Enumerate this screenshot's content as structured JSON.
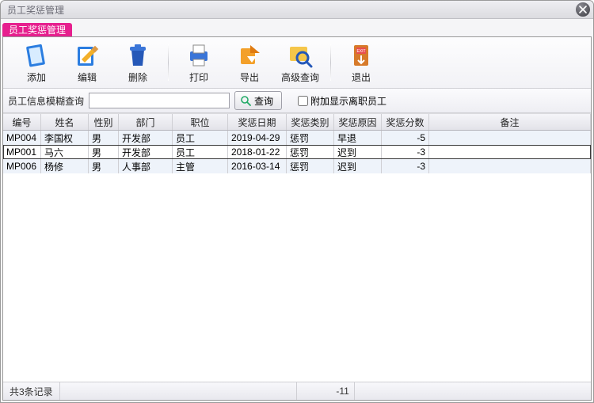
{
  "window": {
    "title": "员工奖惩管理"
  },
  "tab": {
    "label": "员工奖惩管理"
  },
  "toolbar": {
    "add": "添加",
    "edit": "编辑",
    "delete": "删除",
    "print": "打印",
    "export": "导出",
    "adv_query": "高级查询",
    "exit": "退出"
  },
  "filter": {
    "label": "员工信息模糊查询",
    "value": "",
    "query_btn": "查询",
    "show_resigned_label": "附加显示离职员工",
    "show_resigned_checked": false
  },
  "grid": {
    "columns": [
      "编号",
      "姓名",
      "性别",
      "部门",
      "职位",
      "奖惩日期",
      "奖惩类别",
      "奖惩原因",
      "奖惩分数",
      "备注"
    ],
    "rows": [
      {
        "id": "MP004",
        "name": "李国权",
        "gender": "男",
        "dept": "开发部",
        "pos": "员工",
        "date": "2019-04-29",
        "type": "惩罚",
        "reason": "早退",
        "score": "-5",
        "note": "",
        "alt": true,
        "sel": false
      },
      {
        "id": "MP001",
        "name": "马六",
        "gender": "男",
        "dept": "开发部",
        "pos": "员工",
        "date": "2018-01-22",
        "type": "惩罚",
        "reason": "迟到",
        "score": "-3",
        "note": "",
        "alt": false,
        "sel": true
      },
      {
        "id": "MP006",
        "name": "杨修",
        "gender": "男",
        "dept": "人事部",
        "pos": "主管",
        "date": "2016-03-14",
        "type": "惩罚",
        "reason": "迟到",
        "score": "-3",
        "note": "",
        "alt": true,
        "sel": false
      }
    ]
  },
  "status": {
    "count_text": "共3条记录",
    "score_sum": "-11"
  }
}
